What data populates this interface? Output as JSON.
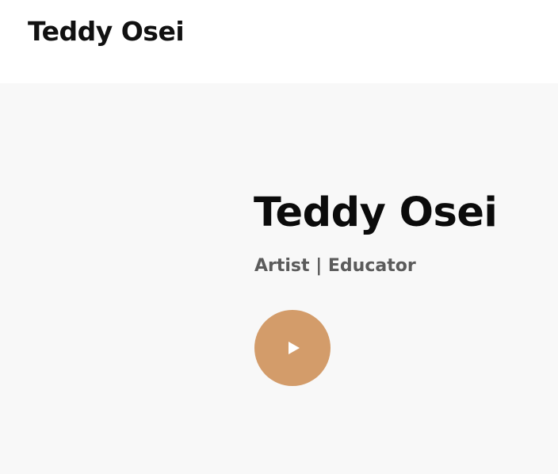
{
  "header": {
    "site_title": "Teddy Osei"
  },
  "hero": {
    "name": "Teddy Osei",
    "subtitle": "Artist | Educator",
    "play_button_icon": "play-icon",
    "accent_color": "#d39c6a"
  }
}
